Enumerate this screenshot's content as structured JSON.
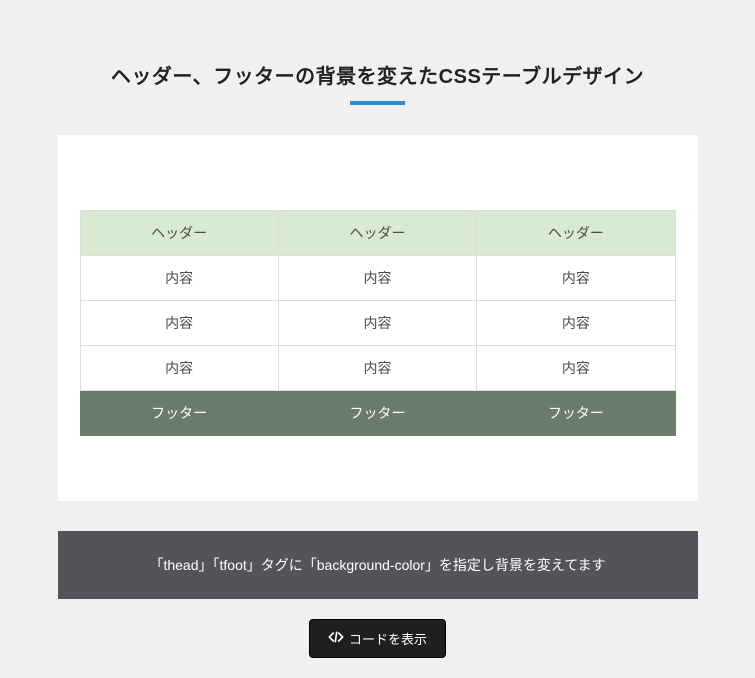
{
  "title": "ヘッダー、フッターの背景を変えたCSSテーブルデザイン",
  "table": {
    "headers": [
      "ヘッダー",
      "ヘッダー",
      "ヘッダー"
    ],
    "rows": [
      [
        "内容",
        "内容",
        "内容"
      ],
      [
        "内容",
        "内容",
        "内容"
      ],
      [
        "内容",
        "内容",
        "内容"
      ]
    ],
    "footers": [
      "フッター",
      "フッター",
      "フッター"
    ]
  },
  "note": "「thead」「tfoot」タグに「background-color」を指定し背景を変えてます",
  "button_label": "コードを表示",
  "colors": {
    "accent": "#2890d6",
    "header_bg": "#d9ead3",
    "footer_bg": "#6b7c6a",
    "note_bg": "#52545a"
  }
}
